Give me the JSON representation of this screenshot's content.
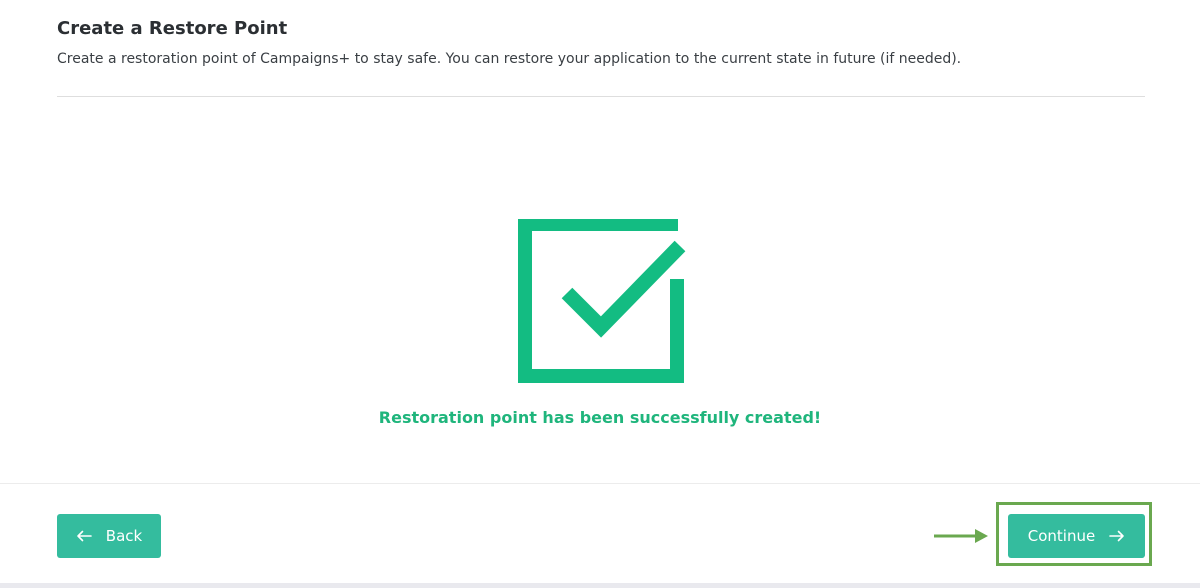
{
  "header": {
    "title": "Create a Restore Point",
    "subtitle": "Create a restoration point of Campaigns+ to stay safe. You can restore your application to the current state in future (if needed)."
  },
  "status": {
    "icon": "checkbox-checked-icon",
    "message": "Restoration point has been successfully created!"
  },
  "footer": {
    "back_label": "Back",
    "back_icon": "arrow-left-icon",
    "continue_label": "Continue",
    "continue_icon": "arrow-right-icon"
  },
  "annotation": {
    "arrow_icon": "arrow-right-icon",
    "highlight_color": "#6aa84f"
  },
  "colors": {
    "accent": "#34bc9e",
    "success": "#1fb57c",
    "title_text": "#2b2f33"
  }
}
